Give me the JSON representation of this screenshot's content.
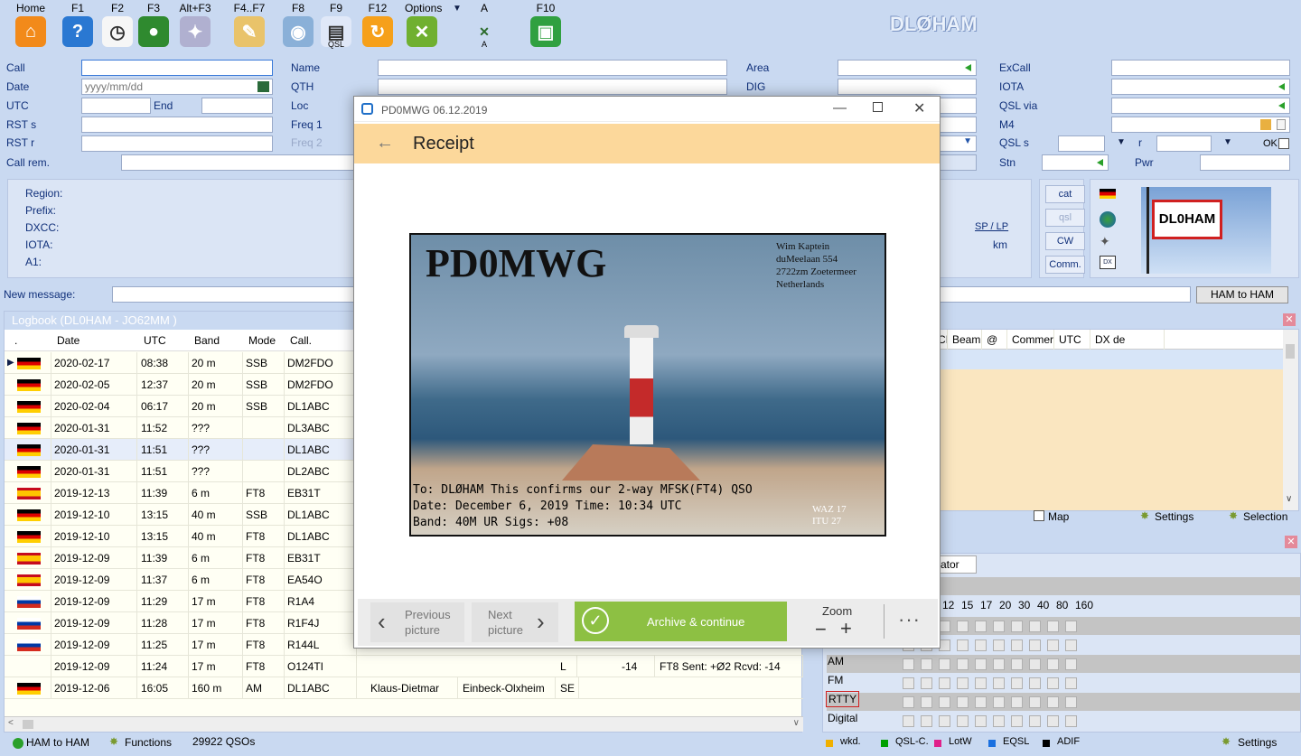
{
  "toolbar": {
    "items": [
      {
        "key": "Home",
        "icon": "home-icon",
        "glyph": "⌂",
        "color": "#f28a1a"
      },
      {
        "key": "F1",
        "icon": "help-icon",
        "glyph": "?",
        "color": "#2a78d2"
      },
      {
        "key": "F2",
        "icon": "clock-icon",
        "glyph": "◷",
        "color": "#f6f6f6"
      },
      {
        "key": "F3",
        "icon": "globe-icon",
        "glyph": "●",
        "color": "#2f8a2f"
      },
      {
        "key": "Alt+F3",
        "icon": "satellite-icon",
        "glyph": "✦",
        "color": "#b0b0d0"
      },
      {
        "key": "F4..F7",
        "icon": "notepad-icon",
        "glyph": "✎",
        "color": "#e9c36a"
      },
      {
        "key": "F8",
        "icon": "cd-icon",
        "glyph": "◉",
        "color": "#8ab0d8"
      },
      {
        "key": "F9",
        "icon": "qsl-card-icon",
        "glyph": "▤",
        "color": "#e0e8f8"
      },
      {
        "key": "F12",
        "icon": "refresh-icon",
        "glyph": "↻",
        "color": "#f6a01a"
      },
      {
        "key": "Options",
        "icon": "tools-icon",
        "glyph": "✕",
        "color": "#70b030"
      },
      {
        "key": "A",
        "icon": "font-tools-icon",
        "glyph": "✕",
        "color": "#c9d9f1"
      },
      {
        "key": "F10",
        "icon": "save-icon",
        "glyph": "▣",
        "color": "#30a040"
      }
    ],
    "qsl_sub": "QSL",
    "font_sub": "A",
    "app_title": "DLØHAM"
  },
  "form": {
    "call": "Call",
    "date": "Date",
    "date_ph": "yyyy/mm/dd",
    "utc": "UTC",
    "end": "End",
    "rsts": "RST s",
    "rstr": "RST r",
    "callrem": "Call rem.",
    "name": "Name",
    "qth": "QTH",
    "loc": "Loc",
    "freq1": "Freq 1",
    "freq2": "Freq 2",
    "area": "Area",
    "dig": "DIG",
    "excall": "ExCall",
    "iota": "IOTA",
    "qslvia": "QSL via",
    "m4": "M4",
    "qsls": "QSL s",
    "r": "r",
    "ok": "OK",
    "stn": "Stn",
    "pwr": "Pwr"
  },
  "info": {
    "labels": [
      "Region:",
      "Prefix:",
      "DXCC:",
      "IOTA:",
      "A1:"
    ],
    "splp": "SP / LP",
    "km": "km"
  },
  "side_buttons": [
    "cat",
    "qsl",
    "CW",
    "Comm."
  ],
  "callsign_flag": "DL0HAM",
  "message": {
    "label": "New message:",
    "button": "HAM to HAM"
  },
  "logbook": {
    "title": "Logbook  (DL0HAM - JO62MM )",
    "columns": [
      ".",
      "Date",
      "UTC",
      "Band",
      "Mode",
      "Call."
    ],
    "rows": [
      {
        "flag": "de",
        "date": "2020-02-17",
        "utc": "08:38",
        "band": "20 m",
        "mode": "SSB",
        "call": "DM2FDO"
      },
      {
        "flag": "de",
        "date": "2020-02-05",
        "utc": "12:37",
        "band": "20 m",
        "mode": "SSB",
        "call": "DM2FDO"
      },
      {
        "flag": "de",
        "date": "2020-02-04",
        "utc": "06:17",
        "band": "20 m",
        "mode": "SSB",
        "call": "DL1ABC"
      },
      {
        "flag": "de",
        "date": "2020-01-31",
        "utc": "11:52",
        "band": "???",
        "mode": "",
        "call": "DL3ABC"
      },
      {
        "flag": "de",
        "date": "2020-01-31",
        "utc": "11:51",
        "band": "???",
        "mode": "",
        "call": "DL1ABC"
      },
      {
        "flag": "de",
        "date": "2020-01-31",
        "utc": "11:51",
        "band": "???",
        "mode": "",
        "call": "DL2ABC"
      },
      {
        "flag": "es",
        "date": "2019-12-13",
        "utc": "11:39",
        "band": "6 m",
        "mode": "FT8",
        "call": "EB31T"
      },
      {
        "flag": "de",
        "date": "2019-12-10",
        "utc": "13:15",
        "band": "40 m",
        "mode": "SSB",
        "call": "DL1ABC"
      },
      {
        "flag": "de",
        "date": "2019-12-10",
        "utc": "13:15",
        "band": "40 m",
        "mode": "FT8",
        "call": "DL1ABC"
      },
      {
        "flag": "es",
        "date": "2019-12-09",
        "utc": "11:39",
        "band": "6 m",
        "mode": "FT8",
        "call": "EB31T"
      },
      {
        "flag": "es",
        "date": "2019-12-09",
        "utc": "11:37",
        "band": "6 m",
        "mode": "FT8",
        "call": "EA54O"
      },
      {
        "flag": "ru",
        "date": "2019-12-09",
        "utc": "11:29",
        "band": "17 m",
        "mode": "FT8",
        "call": "R1A4"
      },
      {
        "flag": "ru",
        "date": "2019-12-09",
        "utc": "11:28",
        "band": "17 m",
        "mode": "FT8",
        "call": "R1F4J"
      },
      {
        "flag": "ru",
        "date": "2019-12-09",
        "utc": "11:25",
        "band": "17 m",
        "mode": "FT8",
        "call": "R144L"
      },
      {
        "flag": "",
        "date": "2019-12-09",
        "utc": "11:24",
        "band": "17 m",
        "mode": "FT8",
        "call": "O124TI"
      },
      {
        "flag": "de",
        "date": "2019-12-06",
        "utc": "16:05",
        "band": "160 m",
        "mode": "AM",
        "call": "DL1ABC"
      }
    ],
    "extra_o124": {
      "l": "L",
      "n": "-14",
      "msg": "FT8  Sent: +Ø2  Rcvd: -14"
    },
    "extra_dl1abc": {
      "name": "Klaus-Dietmar",
      "qth": "Einbeck-Olxheim",
      "loc": "SE"
    }
  },
  "dx": {
    "columns": [
      "CI",
      "Beam",
      "@",
      "Commer",
      "UTC",
      "DX de"
    ],
    "map": "Map",
    "settings": "Settings",
    "selection": "Selection"
  },
  "bands": {
    "tab": "cator",
    "nums": [
      "12",
      "15",
      "17",
      "20",
      "30",
      "40",
      "80",
      "160"
    ],
    "modes": [
      "AM",
      "FM",
      "RTTY",
      "Digital"
    ]
  },
  "status": {
    "ham": "HAM to HAM",
    "functions": "Functions",
    "count": "29922 QSOs",
    "legend": [
      {
        "label": "wkd.",
        "color": "#f0b000"
      },
      {
        "label": "QSL-C.",
        "color": "#00a000"
      },
      {
        "label": "LotW",
        "color": "#e0208a"
      },
      {
        "label": "EQSL",
        "color": "#1a70e0"
      },
      {
        "label": "ADIF",
        "color": "#000000"
      }
    ],
    "settings": "Settings"
  },
  "dialog": {
    "title": "PD0MWG 06.12.2019",
    "heading": "Receipt",
    "card": {
      "callsign": "PD0MWG",
      "address": [
        "Wim Kaptein",
        "duMeelaan 554",
        "2722zm Zoetermeer",
        "Netherlands"
      ],
      "line1": "To: DLØHAM This confirms our 2-way MFSK(FT4) QSO",
      "line2": "Date: December 6, 2019  Time: 10:34 UTC",
      "line3": "Band: 40M UR Sigs: +08",
      "waz": "WAZ  17",
      "itu": "ITU   27"
    },
    "prev": [
      "Previous",
      "picture"
    ],
    "next": [
      "Next",
      "picture"
    ],
    "archive": "Archive & continue",
    "zoom": "Zoom",
    "more": "···"
  }
}
